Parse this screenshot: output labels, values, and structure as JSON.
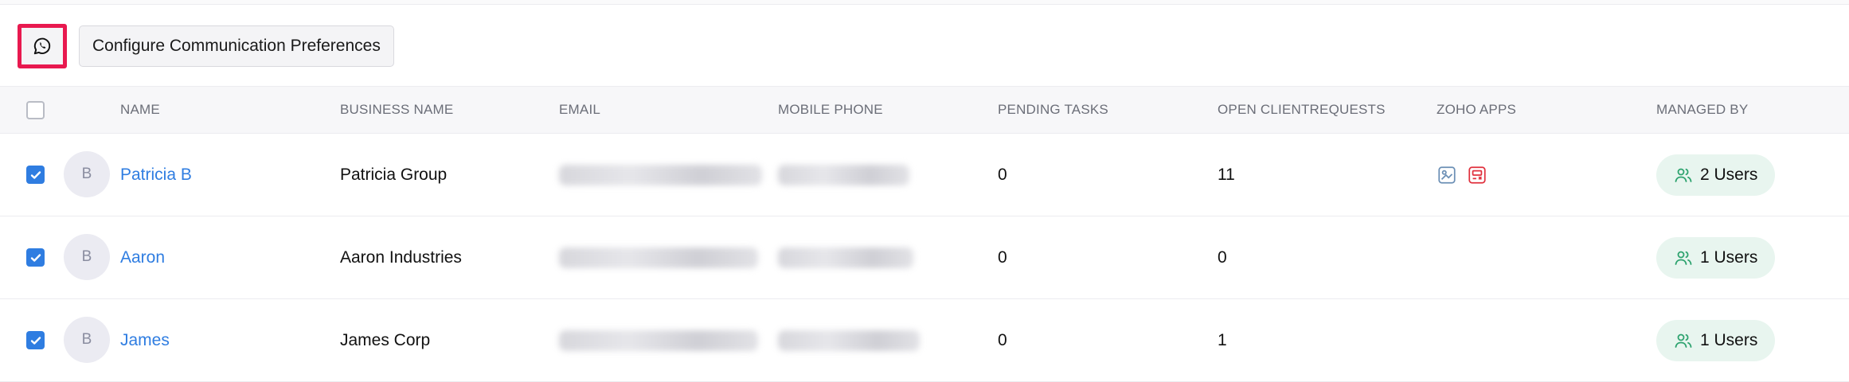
{
  "toolbar": {
    "whatsapp_icon": "whatsapp-icon",
    "configure_label": "Configure Communication Preferences"
  },
  "table": {
    "headers": {
      "name": "NAME",
      "business_name": "BUSINESS NAME",
      "email": "EMAIL",
      "mobile_phone": "MOBILE PHONE",
      "pending_tasks": "PENDING TASKS",
      "open_client_requests": "OPEN CLIENTREQUESTS",
      "zoho_apps": "ZOHO APPS",
      "managed_by": "MANAGED BY"
    },
    "rows": [
      {
        "checked": true,
        "avatar": "B",
        "name": "Patricia B",
        "business_name": "Patricia Group",
        "pending_tasks": "0",
        "open_client_requests": "11",
        "zoho_apps": [
          "zoho-app-icon",
          "zoho-app-icon-red"
        ],
        "managed_by": "2 Users"
      },
      {
        "checked": true,
        "avatar": "B",
        "name": "Aaron",
        "business_name": "Aaron Industries",
        "pending_tasks": "0",
        "open_client_requests": "0",
        "zoho_apps": [],
        "managed_by": "1 Users"
      },
      {
        "checked": true,
        "avatar": "B",
        "name": "James",
        "business_name": "James Corp",
        "pending_tasks": "0",
        "open_client_requests": "1",
        "zoho_apps": [],
        "managed_by": "1 Users"
      }
    ]
  },
  "colors": {
    "accent": "#2f7de1",
    "highlight_border": "#e8194f",
    "pill_bg": "#e8f5ef",
    "pill_icon": "#2ea36f"
  }
}
